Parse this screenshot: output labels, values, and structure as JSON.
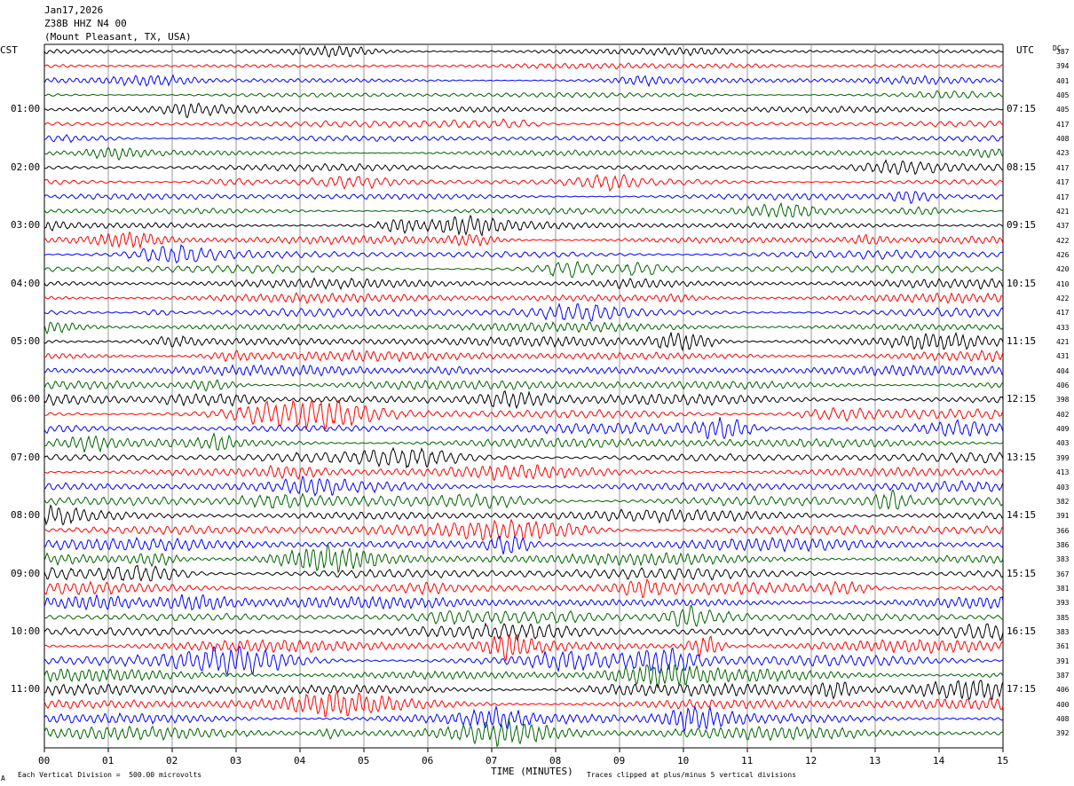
{
  "header": {
    "date": "Jan17,2026",
    "station": "Z38B HHZ N4 00",
    "location": "(Mount Pleasant, TX, USA)"
  },
  "left_axis_label": "CST",
  "right_axis_label": "UTC",
  "dc_label": "DC",
  "footer": {
    "scale_note": "Each Vertical Division =  500.00 microvolts",
    "clip_note": "Traces clipped at plus/minus 5 vertical divisions",
    "corner_mark": "A"
  },
  "colors": {
    "cycle": [
      "#000000",
      "#ff0000",
      "#0000ff",
      "#006400"
    ],
    "grid": "#808080"
  },
  "chart_data": {
    "type": "line",
    "title": "Z38B HHZ N4 00",
    "xlabel": "TIME (MINUTES)",
    "ylabel": "",
    "x_ticks": [
      "00",
      "01",
      "02",
      "03",
      "04",
      "05",
      "06",
      "07",
      "08",
      "09",
      "10",
      "11",
      "12",
      "13",
      "14",
      "15"
    ],
    "xlim": [
      0,
      15
    ],
    "traces_per_hour": 4,
    "left_hour_labels": [
      "01:00",
      "02:00",
      "03:00",
      "04:00",
      "05:00",
      "06:00",
      "07:00",
      "08:00",
      "09:00",
      "10:00",
      "11:00"
    ],
    "right_hour_labels": [
      "07:15",
      "08:15",
      "09:15",
      "10:15",
      "11:15",
      "12:15",
      "13:15",
      "14:15",
      "15:15",
      "16:15",
      "17:15"
    ],
    "dc_offsets": [
      387,
      394,
      401,
      405,
      405,
      417,
      408,
      423,
      417,
      417,
      417,
      421,
      437,
      422,
      426,
      420,
      410,
      422,
      417,
      433,
      421,
      431,
      404,
      406,
      398,
      402,
      409,
      403,
      399,
      413,
      403,
      382,
      391,
      366,
      386,
      383,
      367,
      381,
      393,
      385,
      383,
      361,
      391,
      387,
      406,
      400,
      408,
      392
    ],
    "amplitude_by_hour": [
      0.35,
      0.4,
      0.45,
      0.55,
      0.62,
      0.68,
      0.7,
      0.72,
      0.8,
      0.78,
      0.8,
      0.8
    ]
  }
}
